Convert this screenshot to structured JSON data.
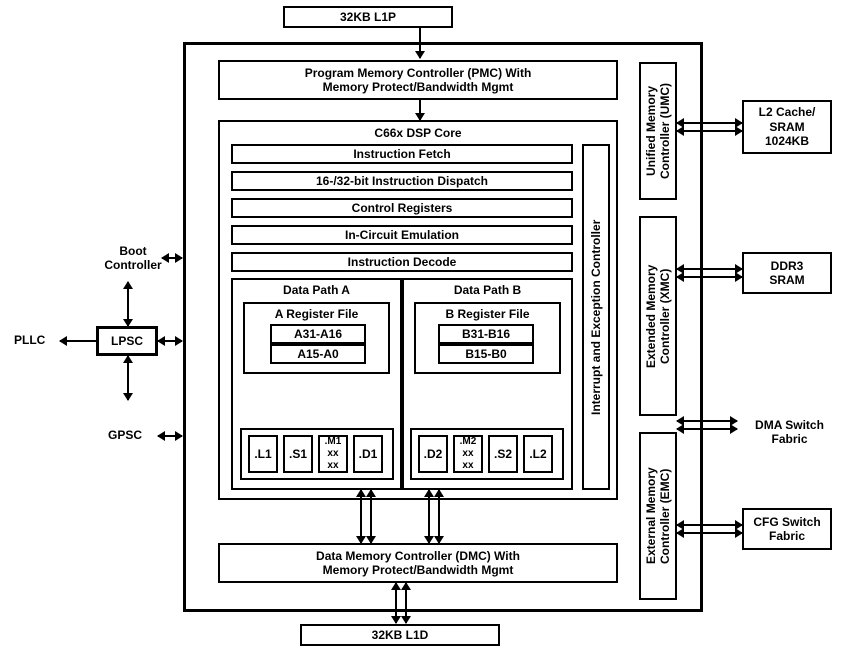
{
  "top_l1p": "32KB L1P",
  "pmc": "Program Memory Controller (PMC) With\nMemory Protect/Bandwidth Mgmt",
  "core_title": "C66x DSP Core",
  "pipeline": {
    "fetch": "Instruction Fetch",
    "dispatch": "16-/32-bit Instruction Dispatch",
    "ctrl": "Control Registers",
    "ice": "In-Circuit Emulation",
    "decode": "Instruction Decode"
  },
  "dp_a": "Data Path A",
  "dp_b": "Data Path B",
  "regA_title": "A Register File",
  "regA_hi": "A31-A16",
  "regA_lo": "A15-A0",
  "regB_title": "B Register File",
  "regB_hi": "B31-B16",
  "regB_lo": "B15-B0",
  "fu": {
    "L1": ".L1",
    "S1": ".S1",
    "M1": ".M1\nxx\nxx",
    "D1": ".D1",
    "D2": ".D2",
    "M2": ".M2\nxx\nxx",
    "S2": ".S2",
    "L2": ".L2"
  },
  "intc": "Interrupt and Exception Controller",
  "dmc": "Data Memory Controller (DMC) With\nMemory Protect/Bandwidth Mgmt",
  "bottom_l1d": "32KB L1D",
  "umc": "Unified Memory\nController (UMC)",
  "xmc": "Extended Memory\nController (XMC)",
  "emc": "External Memory\nController (EMC)",
  "l2": "L2 Cache/\nSRAM\n1024KB",
  "ddr3": "DDR3\nSRAM",
  "dma": "DMA Switch\nFabric",
  "cfg": "CFG Switch\nFabric",
  "boot": "Boot\nController",
  "lpsc": "LPSC",
  "pllc": "PLLC",
  "gpsc": "GPSC"
}
